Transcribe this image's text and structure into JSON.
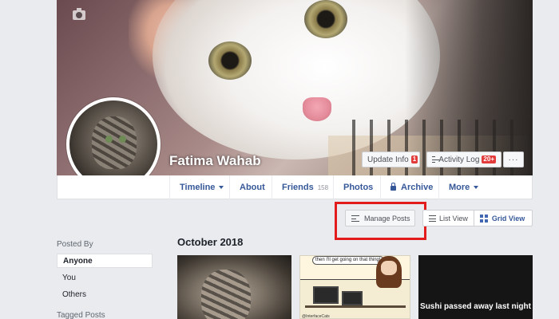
{
  "profile": {
    "name": "Fatima Wahab"
  },
  "cover_actions": {
    "update_info": "Update Info",
    "update_info_count": "1",
    "activity_log": "Activity Log",
    "activity_log_count": "20+",
    "more": "···"
  },
  "nav": {
    "timeline": "Timeline",
    "about": "About",
    "friends": "Friends",
    "friends_count": "158",
    "photos": "Photos",
    "archive": "Archive",
    "more": "More"
  },
  "toolbar": {
    "manage_posts": "Manage Posts",
    "list_view": "List View",
    "grid_view": "Grid View"
  },
  "filters": {
    "posted_by_title": "Posted By",
    "items": [
      "Anyone",
      "You",
      "Others"
    ],
    "tagged_posts_title": "Tagged Posts"
  },
  "timeline": {
    "month": "October 2018",
    "comic_speech": "then I'll get going on that thing!",
    "comic_credit": "@InterfaceCats",
    "sushi_caption": "Sushi passed away last night"
  },
  "colors": {
    "link": "#365899",
    "highlight": "#e21c1c",
    "badge": "#e23b3b"
  }
}
